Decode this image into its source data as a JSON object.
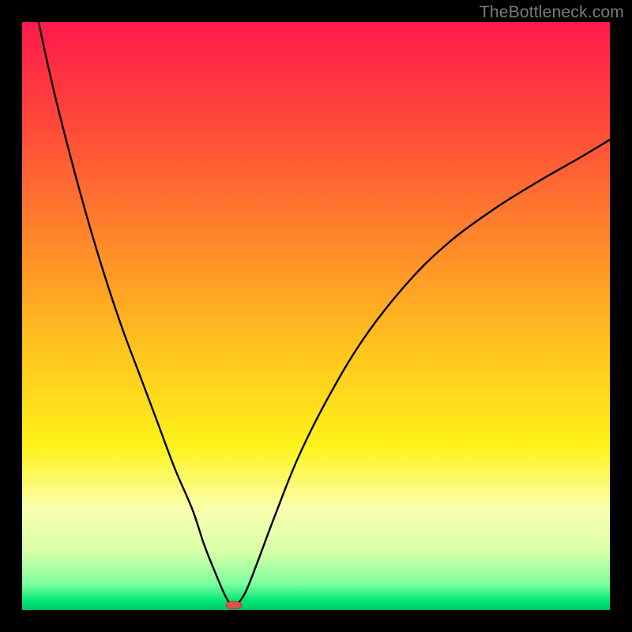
{
  "watermark": "TheBottleneck.com",
  "colors": {
    "frame": "#000000",
    "curve": "#000000",
    "marker_fill": "#d9534f",
    "marker_stroke": "#b33e3b",
    "gradient_stops": [
      {
        "offset": 0.0,
        "color": "#ff1a4b"
      },
      {
        "offset": 0.18,
        "color": "#ff4a3a"
      },
      {
        "offset": 0.38,
        "color": "#ff8a2a"
      },
      {
        "offset": 0.55,
        "color": "#ffc21e"
      },
      {
        "offset": 0.72,
        "color": "#fff21a"
      },
      {
        "offset": 0.83,
        "color": "#faffb0"
      },
      {
        "offset": 0.9,
        "color": "#d8ffa8"
      },
      {
        "offset": 0.955,
        "color": "#7fff9e"
      },
      {
        "offset": 0.985,
        "color": "#00e676"
      },
      {
        "offset": 1.0,
        "color": "#00c868"
      }
    ]
  },
  "chart_data": {
    "type": "line",
    "title": "",
    "xlabel": "",
    "ylabel": "",
    "xlim": [
      0,
      100
    ],
    "ylim": [
      0,
      100
    ],
    "legend": false,
    "grid": false,
    "note": "Bottleneck-style V-curve. y represents bottleneck percentage (higher = worse, red zone). Minimum near x≈35 is the balanced point (green zone).",
    "series": [
      {
        "name": "bottleneck-left",
        "x": [
          0,
          2,
          5,
          8,
          11,
          14,
          17,
          20,
          23,
          26,
          29,
          31,
          33,
          34.5,
          35.5
        ],
        "values": [
          115,
          104,
          90,
          78,
          67,
          57,
          48,
          40,
          32,
          24,
          17,
          11,
          6,
          2.5,
          0.8
        ]
      },
      {
        "name": "bottleneck-right",
        "x": [
          36.5,
          38,
          40,
          43,
          47,
          52,
          58,
          65,
          72,
          80,
          88,
          95,
          100
        ],
        "values": [
          0.8,
          3,
          8,
          16,
          26,
          36,
          46,
          55,
          62,
          68,
          73,
          77,
          80
        ]
      }
    ],
    "marker": {
      "x": 36,
      "y": 0.8
    }
  }
}
